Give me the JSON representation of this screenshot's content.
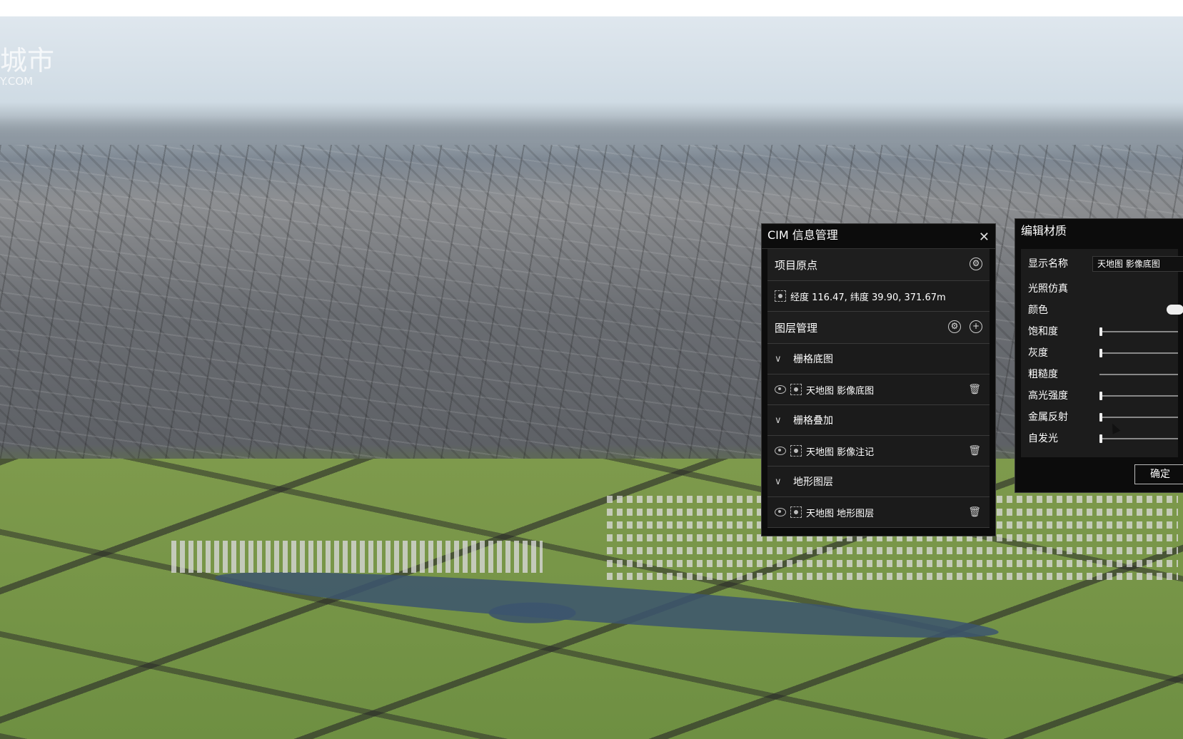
{
  "watermark": {
    "line1": "城市",
    "line2": "Y.COM"
  },
  "cim_panel": {
    "title": "CIM 信息管理",
    "close_label": "✕",
    "origin_section": "项目原点",
    "origin_coords": "经度 116.47, 纬度 39.90, 371.67m",
    "layer_section": "图层管理",
    "groups": [
      {
        "name": "栅格底图",
        "layer": "天地图 影像底图"
      },
      {
        "name": "栅格叠加",
        "layer": "天地图 影像注记"
      },
      {
        "name": "地形图层",
        "layer": "天地图 地形图层"
      }
    ]
  },
  "material_panel": {
    "title": "编辑材质",
    "display_name_label": "显示名称",
    "display_name_value": "天地图 影像底图",
    "lighting_label": "光照仿真",
    "color_label": "颜色",
    "sliders": [
      {
        "label": "饱和度",
        "value": 0
      },
      {
        "label": "灰度",
        "value": 0
      },
      {
        "label": "粗糙度",
        "value": null
      },
      {
        "label": "高光强度",
        "value": 0
      },
      {
        "label": "金属反射",
        "value": 0
      },
      {
        "label": "自发光",
        "value": 0
      }
    ],
    "confirm_label": "确定"
  }
}
